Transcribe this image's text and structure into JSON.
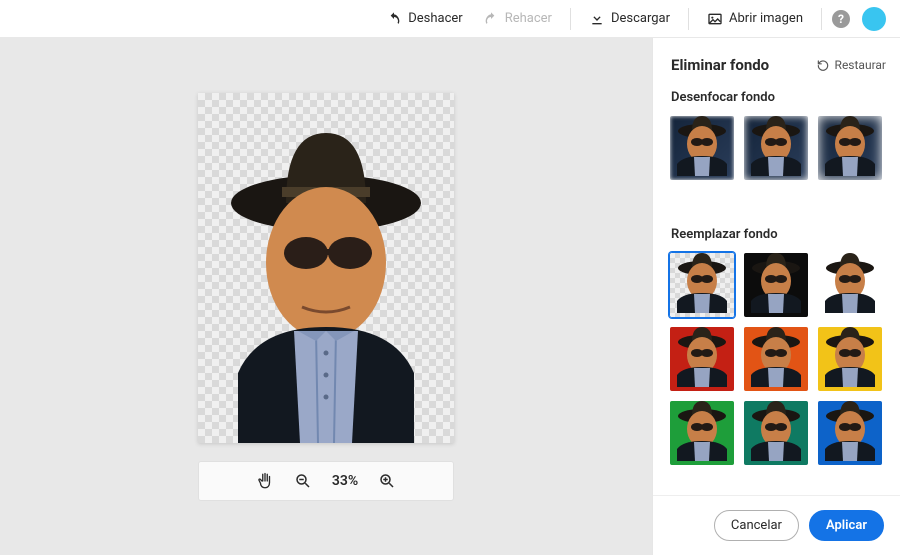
{
  "toolbar": {
    "undo": "Deshacer",
    "redo": "Rehacer",
    "download": "Descargar",
    "open_image": "Abrir imagen"
  },
  "zoom": {
    "value": "33%"
  },
  "panel": {
    "title": "Eliminar fondo",
    "restore": "Restaurar",
    "blur_label": "Desenfocar fondo",
    "replace_label": "Reemplazar fondo",
    "blur_options": [
      {
        "id": "blur-1",
        "level": "blur"
      },
      {
        "id": "blur-2",
        "level": "blur2"
      },
      {
        "id": "blur-3",
        "level": "blur3"
      }
    ],
    "replace_options": [
      {
        "id": "bg-transparent",
        "type": "transparent",
        "selected": true
      },
      {
        "id": "bg-black",
        "color": "#0c0c0c"
      },
      {
        "id": "bg-white",
        "color": "#ffffff"
      },
      {
        "id": "bg-red",
        "color": "#c42014"
      },
      {
        "id": "bg-orange",
        "color": "#e25415"
      },
      {
        "id": "bg-yellow",
        "color": "#f2c318"
      },
      {
        "id": "bg-green",
        "color": "#1e9e3a"
      },
      {
        "id": "bg-teal",
        "color": "#0f7a62"
      },
      {
        "id": "bg-blue",
        "color": "#0d63c9"
      }
    ]
  },
  "footer": {
    "cancel": "Cancelar",
    "apply": "Aplicar"
  },
  "colors": {
    "accent": "#1473e6"
  }
}
